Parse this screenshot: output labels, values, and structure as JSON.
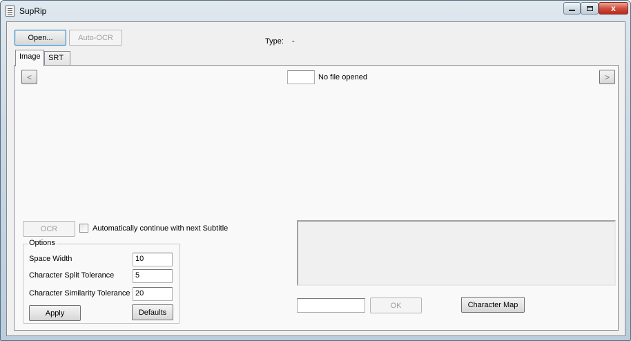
{
  "window": {
    "title": "SupRip",
    "icon": "document-icon"
  },
  "titlebar_controls": {
    "minimize_icon": "minimize-icon",
    "maximize_icon": "maximize-icon",
    "close_glyph": "x"
  },
  "toolbar": {
    "open_label": "Open...",
    "auto_ocr_label": "Auto-OCR",
    "type_label": "Type:",
    "type_value": "-"
  },
  "tabs": [
    {
      "label": "Image",
      "active": true
    },
    {
      "label": "SRT",
      "active": false
    }
  ],
  "image_tab": {
    "prev_glyph": "<",
    "next_glyph": ">",
    "page_value": "",
    "status_text": "No file opened",
    "ocr_label": "OCR",
    "auto_continue_label": "Automatically continue with next Subtitle",
    "auto_continue_checked": false,
    "options": {
      "caption": "Options",
      "space_width_label": "Space Width",
      "space_width_value": "10",
      "split_tol_label": "Character Split Tolerance",
      "split_tol_value": "5",
      "similarity_tol_label": "Character Similarity Tolerance",
      "similarity_tol_value": "20",
      "apply_label": "Apply",
      "defaults_label": "Defaults"
    },
    "char_input_value": "",
    "ok_label": "OK",
    "char_map_label": "Character Map"
  }
}
